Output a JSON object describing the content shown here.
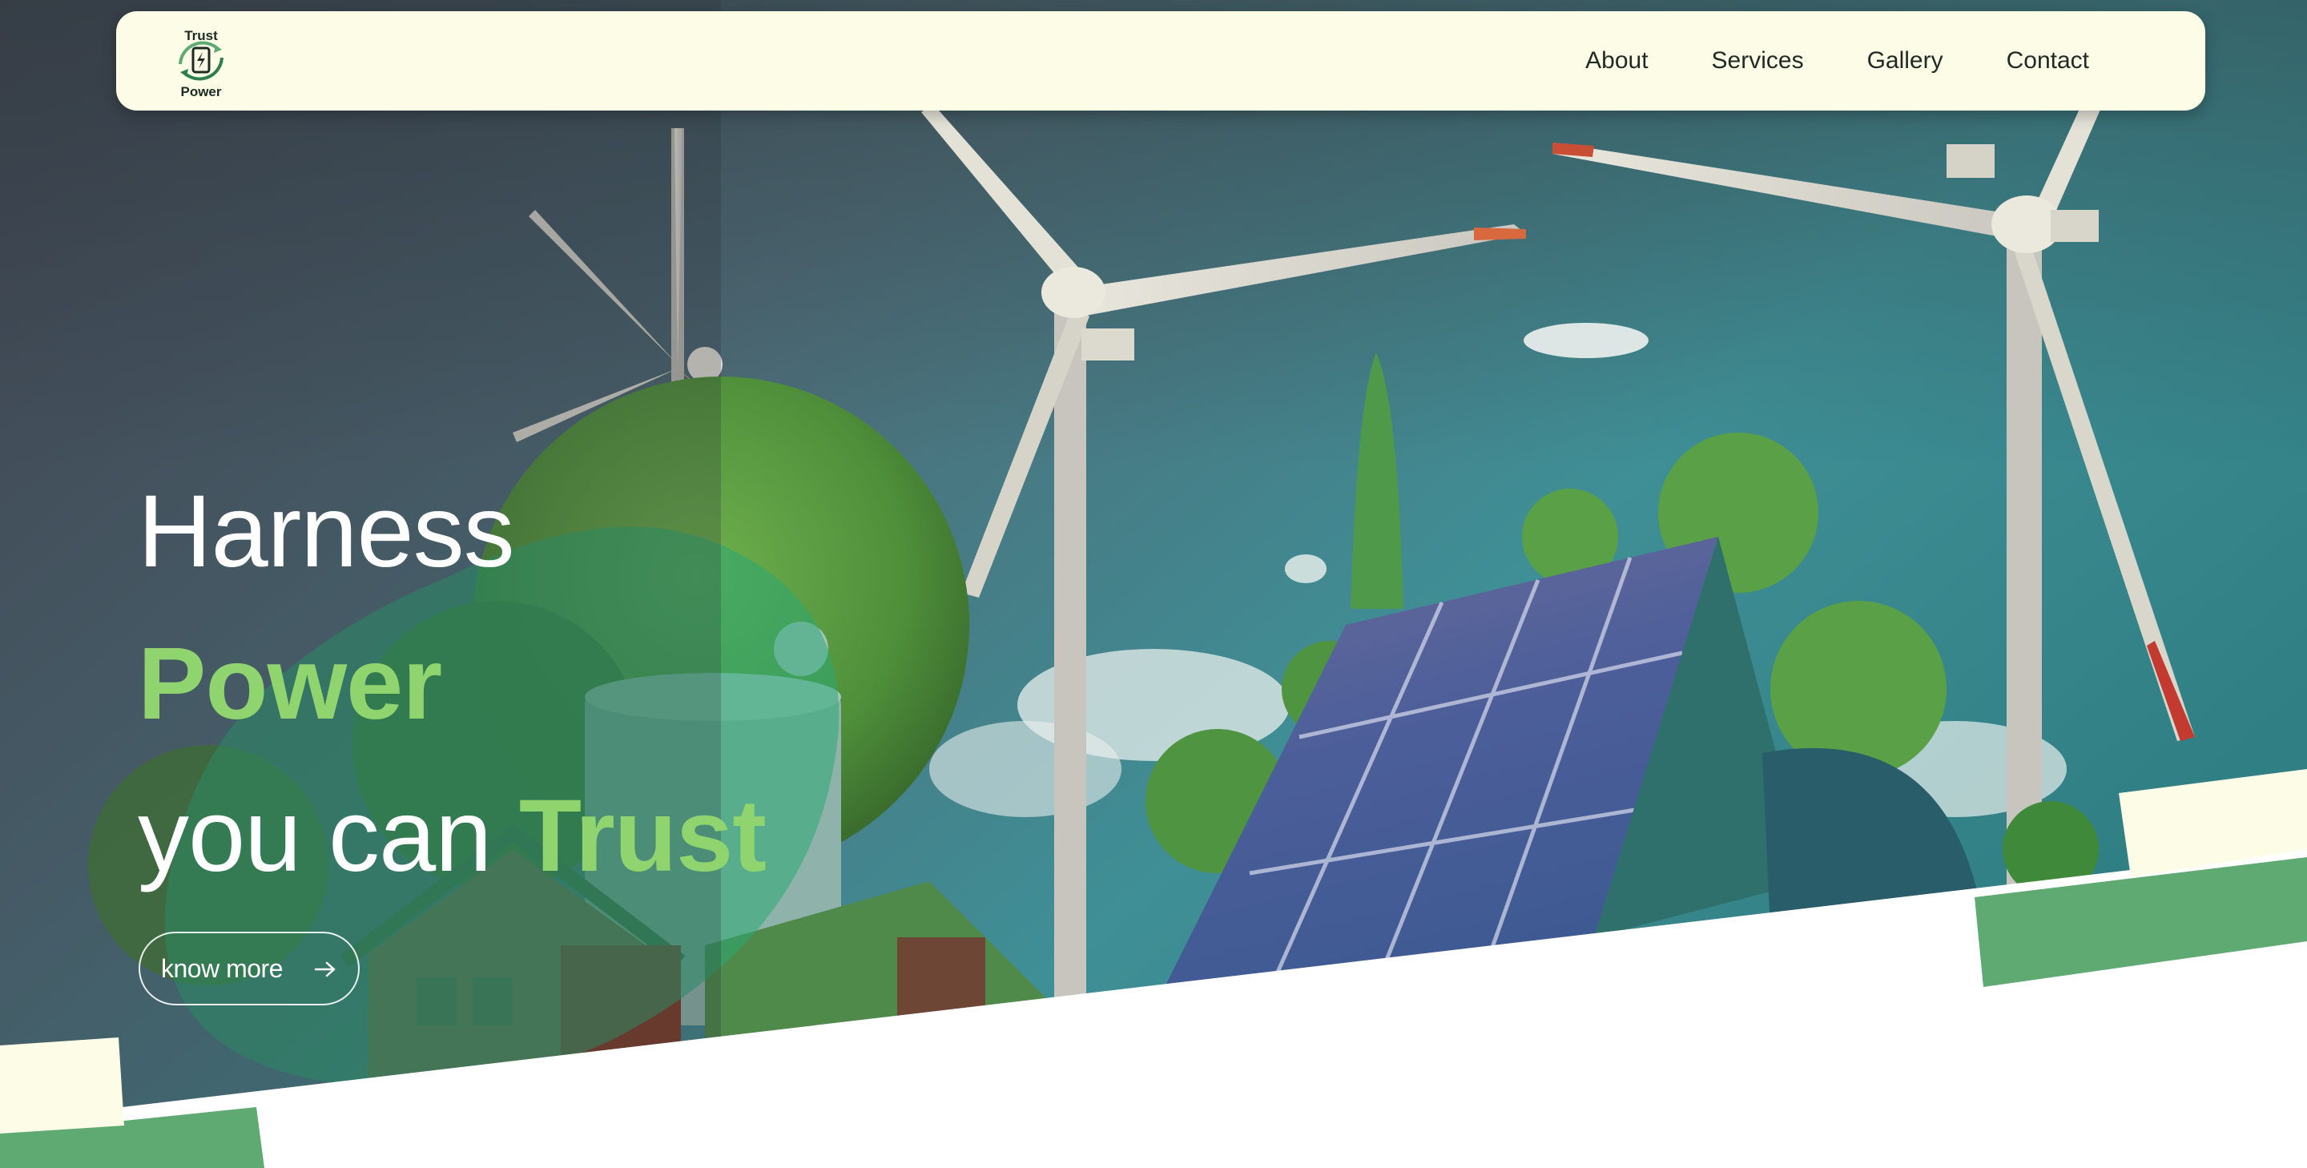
{
  "brand": {
    "logo_top": "Trust",
    "logo_bottom": "Power"
  },
  "nav": {
    "items": [
      {
        "label": "About"
      },
      {
        "label": "Services"
      },
      {
        "label": "Gallery"
      },
      {
        "label": "Contact"
      }
    ]
  },
  "hero": {
    "line1": "Harness",
    "line2": "Power",
    "line3_prefix": "you can ",
    "line3_accent": "Trust",
    "cta_label": "know more"
  },
  "colors": {
    "nav_bg": "#fdfce7",
    "accent_green": "#8fd46f",
    "band_green": "#5faa72",
    "band_cream": "#fdfce7"
  }
}
